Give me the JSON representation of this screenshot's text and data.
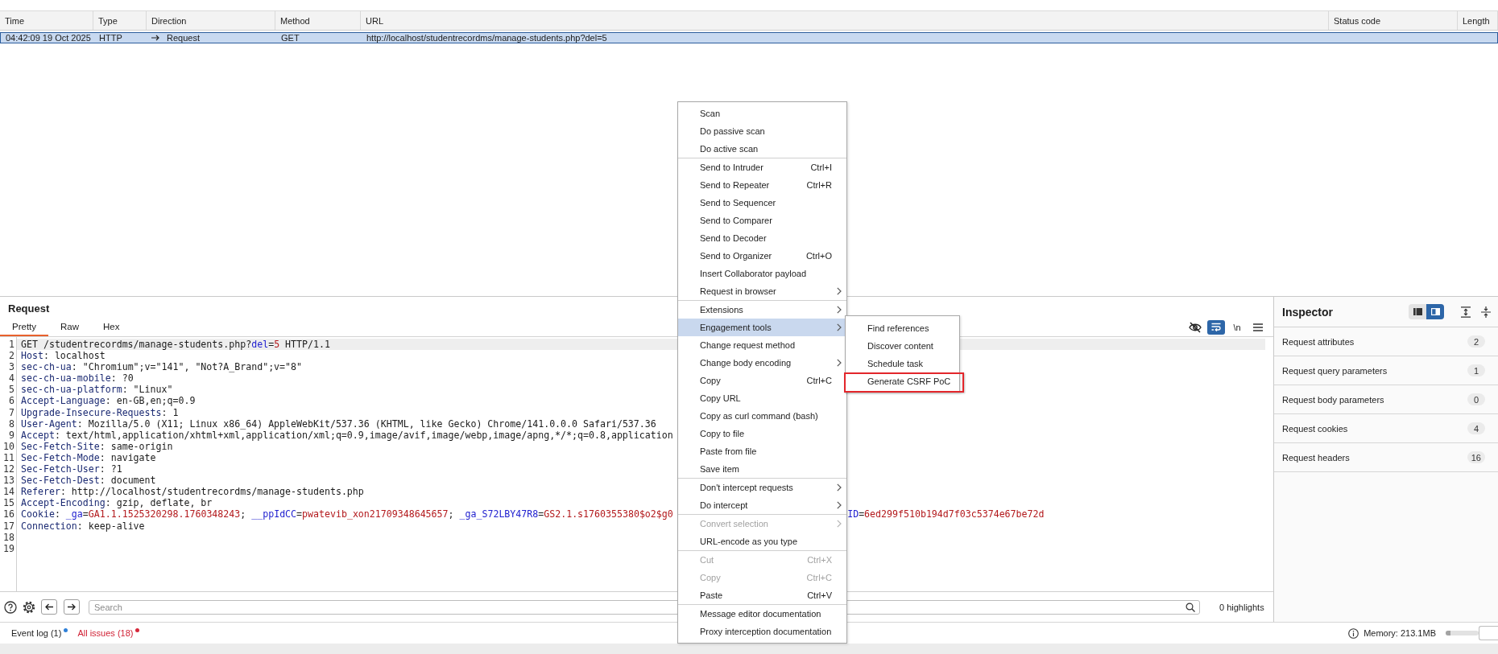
{
  "table": {
    "columns": [
      "Time",
      "Type",
      "Direction",
      "Method",
      "URL",
      "Status code",
      "Length"
    ],
    "rows": [
      {
        "selected": true,
        "time": "04:42:09 19 Oct 2025",
        "type": "HTTP",
        "direction": "Request",
        "method": "GET",
        "url": "http://localhost/studentrecordms/manage-students.php?del=5"
      }
    ]
  },
  "request_editor": {
    "title": "Request",
    "tabs": [
      {
        "label": "Pretty",
        "selected": true
      },
      {
        "label": "Raw",
        "selected": false
      },
      {
        "label": "Hex",
        "selected": false
      }
    ],
    "toggles": [
      {
        "kind": "hide",
        "on": false
      },
      {
        "kind": "wrap",
        "on": true
      },
      {
        "kind": "newline",
        "label": "\\n",
        "on": false
      }
    ],
    "lines": [
      {
        "number": "1",
        "current": true,
        "segments": [
          {
            "kind": "plain",
            "text": "GET /studentrecordms/manage-students.php?"
          },
          {
            "kind": "param",
            "text": "del"
          },
          {
            "kind": "plain",
            "text": "="
          },
          {
            "kind": "value",
            "text": "5"
          },
          {
            "kind": "plain",
            "text": " HTTP/1.1"
          }
        ]
      },
      {
        "number": "2",
        "current": false,
        "segments": [
          {
            "kind": "header",
            "text": "Host"
          },
          {
            "kind": "plain",
            "text": ": localhost"
          }
        ]
      },
      {
        "number": "3",
        "current": false,
        "segments": [
          {
            "kind": "header",
            "text": "sec-ch-ua"
          },
          {
            "kind": "plain",
            "text": ": \"Chromium\";v=\"141\", \"Not?A_Brand\";v=\"8\""
          }
        ]
      },
      {
        "number": "4",
        "current": false,
        "segments": [
          {
            "kind": "header",
            "text": "sec-ch-ua-mobile"
          },
          {
            "kind": "plain",
            "text": ": ?0"
          }
        ]
      },
      {
        "number": "5",
        "current": false,
        "segments": [
          {
            "kind": "header",
            "text": "sec-ch-ua-platform"
          },
          {
            "kind": "plain",
            "text": ": \"Linux\""
          }
        ]
      },
      {
        "number": "6",
        "current": false,
        "segments": [
          {
            "kind": "header",
            "text": "Accept-Language"
          },
          {
            "kind": "plain",
            "text": ": en-GB,en;q=0.9"
          }
        ]
      },
      {
        "number": "7",
        "current": false,
        "segments": [
          {
            "kind": "header",
            "text": "Upgrade-Insecure-Requests"
          },
          {
            "kind": "plain",
            "text": ": 1"
          }
        ]
      },
      {
        "number": "8",
        "current": false,
        "segments": [
          {
            "kind": "header",
            "text": "User-Agent"
          },
          {
            "kind": "plain",
            "text": ": Mozilla/5.0 (X11; Linux x86_64) AppleWebKit/537.36 (KHTML, like Gecko) Chrome/141.0.0.0 Safari/537.36"
          }
        ]
      },
      {
        "number": "9",
        "current": false,
        "segments": [
          {
            "kind": "header",
            "text": "Accept"
          },
          {
            "kind": "plain",
            "text": ": text/html,application/xhtml+xml,application/xml;q=0.9,image/avif,image/webp,image/apng,*/*;q=0.8,application"
          }
        ]
      },
      {
        "number": "10",
        "current": false,
        "segments": [
          {
            "kind": "header",
            "text": "Sec-Fetch-Site"
          },
          {
            "kind": "plain",
            "text": ": same-origin"
          }
        ]
      },
      {
        "number": "11",
        "current": false,
        "segments": [
          {
            "kind": "header",
            "text": "Sec-Fetch-Mode"
          },
          {
            "kind": "plain",
            "text": ": navigate"
          }
        ]
      },
      {
        "number": "12",
        "current": false,
        "segments": [
          {
            "kind": "header",
            "text": "Sec-Fetch-User"
          },
          {
            "kind": "plain",
            "text": ": ?1"
          }
        ]
      },
      {
        "number": "13",
        "current": false,
        "segments": [
          {
            "kind": "header",
            "text": "Sec-Fetch-Dest"
          },
          {
            "kind": "plain",
            "text": ": document"
          }
        ]
      },
      {
        "number": "14",
        "current": false,
        "segments": [
          {
            "kind": "header",
            "text": "Referer"
          },
          {
            "kind": "plain",
            "text": ": http://localhost/studentrecordms/manage-students.php"
          }
        ]
      },
      {
        "number": "15",
        "current": false,
        "segments": [
          {
            "kind": "header",
            "text": "Accept-Encoding"
          },
          {
            "kind": "plain",
            "text": ": gzip, deflate, br"
          }
        ]
      },
      {
        "number": "16",
        "current": false,
        "segments": [
          {
            "kind": "header",
            "text": "Cookie"
          },
          {
            "kind": "plain",
            "text": ": "
          },
          {
            "kind": "param",
            "text": "_ga"
          },
          {
            "kind": "plain",
            "text": "="
          },
          {
            "kind": "value",
            "text": "GA1.1.1525320298.1760348243"
          },
          {
            "kind": "plain",
            "text": "; "
          },
          {
            "kind": "param",
            "text": "__ppIdCC"
          },
          {
            "kind": "plain",
            "text": "="
          },
          {
            "kind": "value",
            "text": "pwatevib_xon21709348645657"
          },
          {
            "kind": "plain",
            "text": "; "
          },
          {
            "kind": "param",
            "text": "_ga_S72LBY47R8"
          },
          {
            "kind": "plain",
            "text": "="
          },
          {
            "kind": "value",
            "text": "GS2.1.s1760355380$o2$g0"
          }
        ],
        "segments_right_of_menu": [
          {
            "kind": "param",
            "text": "ID"
          },
          {
            "kind": "plain",
            "text": "="
          },
          {
            "kind": "value",
            "text": "6ed299f510b194d7f03c5374e67be72d"
          }
        ]
      },
      {
        "number": "17",
        "current": false,
        "segments": [
          {
            "kind": "header",
            "text": "Connection"
          },
          {
            "kind": "plain",
            "text": ": keep-alive"
          }
        ]
      },
      {
        "number": "18",
        "current": false
      },
      {
        "number": "19",
        "current": false
      }
    ]
  },
  "search_bar": {
    "placeholder": "Search",
    "highlights": "0 highlights"
  },
  "inspector": {
    "title": "Inspector",
    "layout_buttons": [
      {
        "kind": "list",
        "selected": false
      },
      {
        "kind": "split",
        "selected": true
      }
    ],
    "sections": [
      {
        "label": "Request attributes",
        "count": "2"
      },
      {
        "label": "Request query parameters",
        "count": "1"
      },
      {
        "label": "Request body parameters",
        "count": "0"
      },
      {
        "label": "Request cookies",
        "count": "4"
      },
      {
        "label": "Request headers",
        "count": "16"
      }
    ]
  },
  "status_bar": {
    "items": [
      {
        "label": "Event log (1)",
        "alert": false,
        "color": "#2f80d8"
      },
      {
        "label": "All issues (18)",
        "alert": true,
        "color": "#d6283a"
      }
    ],
    "memory": {
      "label": "Memory: 213.1MB",
      "level": 0.15
    }
  },
  "context_menu": {
    "groups": [
      {
        "items": [
          {
            "label": "Scan",
            "has_submenu": false,
            "disabled": false,
            "selected": false
          },
          {
            "label": "Do passive scan",
            "has_submenu": false,
            "disabled": false,
            "selected": false
          },
          {
            "label": "Do active scan",
            "has_submenu": false,
            "disabled": false,
            "selected": false
          }
        ]
      },
      {
        "items": [
          {
            "label": "Send to Intruder",
            "shortcut": "Ctrl+I",
            "has_submenu": false,
            "disabled": false,
            "selected": false
          },
          {
            "label": "Send to Repeater",
            "shortcut": "Ctrl+R",
            "has_submenu": false,
            "disabled": false,
            "selected": false
          },
          {
            "label": "Send to Sequencer",
            "has_submenu": false,
            "disabled": false,
            "selected": false
          },
          {
            "label": "Send to Comparer",
            "has_submenu": false,
            "disabled": false,
            "selected": false
          },
          {
            "label": "Send to Decoder",
            "has_submenu": false,
            "disabled": false,
            "selected": false
          },
          {
            "label": "Send to Organizer",
            "shortcut": "Ctrl+O",
            "has_submenu": false,
            "disabled": false,
            "selected": false
          },
          {
            "label": "Insert Collaborator payload",
            "has_submenu": false,
            "disabled": false,
            "selected": false
          },
          {
            "label": "Request in browser",
            "has_submenu": true,
            "disabled": false,
            "selected": false
          }
        ]
      },
      {
        "items": [
          {
            "label": "Extensions",
            "has_submenu": true,
            "disabled": false,
            "selected": false
          },
          {
            "label": "Engagement tools",
            "has_submenu": true,
            "disabled": false,
            "selected": true
          },
          {
            "label": "Change request method",
            "has_submenu": false,
            "disabled": false,
            "selected": false
          },
          {
            "label": "Change body encoding",
            "has_submenu": true,
            "disabled": false,
            "selected": false
          },
          {
            "label": "Copy",
            "shortcut": "Ctrl+C",
            "has_submenu": false,
            "disabled": false,
            "selected": false
          },
          {
            "label": "Copy URL",
            "has_submenu": false,
            "disabled": false,
            "selected": false
          },
          {
            "label": "Copy as curl command (bash)",
            "has_submenu": false,
            "disabled": false,
            "selected": false
          },
          {
            "label": "Copy to file",
            "has_submenu": false,
            "disabled": false,
            "selected": false
          },
          {
            "label": "Paste from file",
            "has_submenu": false,
            "disabled": false,
            "selected": false
          },
          {
            "label": "Save item",
            "has_submenu": false,
            "disabled": false,
            "selected": false
          }
        ]
      },
      {
        "items": [
          {
            "label": "Don't intercept requests",
            "has_submenu": true,
            "disabled": false,
            "selected": false
          },
          {
            "label": "Do intercept",
            "has_submenu": true,
            "disabled": false,
            "selected": false
          }
        ]
      },
      {
        "items": [
          {
            "label": "Convert selection",
            "has_submenu": true,
            "disabled": true,
            "selected": false
          },
          {
            "label": "URL-encode as you type",
            "has_submenu": false,
            "disabled": false,
            "selected": false
          }
        ]
      },
      {
        "items": [
          {
            "label": "Cut",
            "shortcut": "Ctrl+X",
            "has_submenu": false,
            "disabled": true,
            "selected": false
          },
          {
            "label": "Copy",
            "shortcut": "Ctrl+C",
            "has_submenu": false,
            "disabled": true,
            "selected": false
          },
          {
            "label": "Paste",
            "shortcut": "Ctrl+V",
            "has_submenu": false,
            "disabled": false,
            "selected": false
          }
        ]
      },
      {
        "items": [
          {
            "label": "Message editor documentation",
            "has_submenu": false,
            "disabled": false,
            "selected": false
          },
          {
            "label": "Proxy interception documentation",
            "has_submenu": false,
            "disabled": false,
            "selected": false
          }
        ]
      }
    ]
  },
  "submenu": {
    "items": [
      {
        "label": "Find references",
        "outlined": false
      },
      {
        "label": "Discover content",
        "outlined": false
      },
      {
        "label": "Schedule task",
        "outlined": false
      },
      {
        "label": "Generate CSRF PoC",
        "outlined": true
      }
    ]
  }
}
